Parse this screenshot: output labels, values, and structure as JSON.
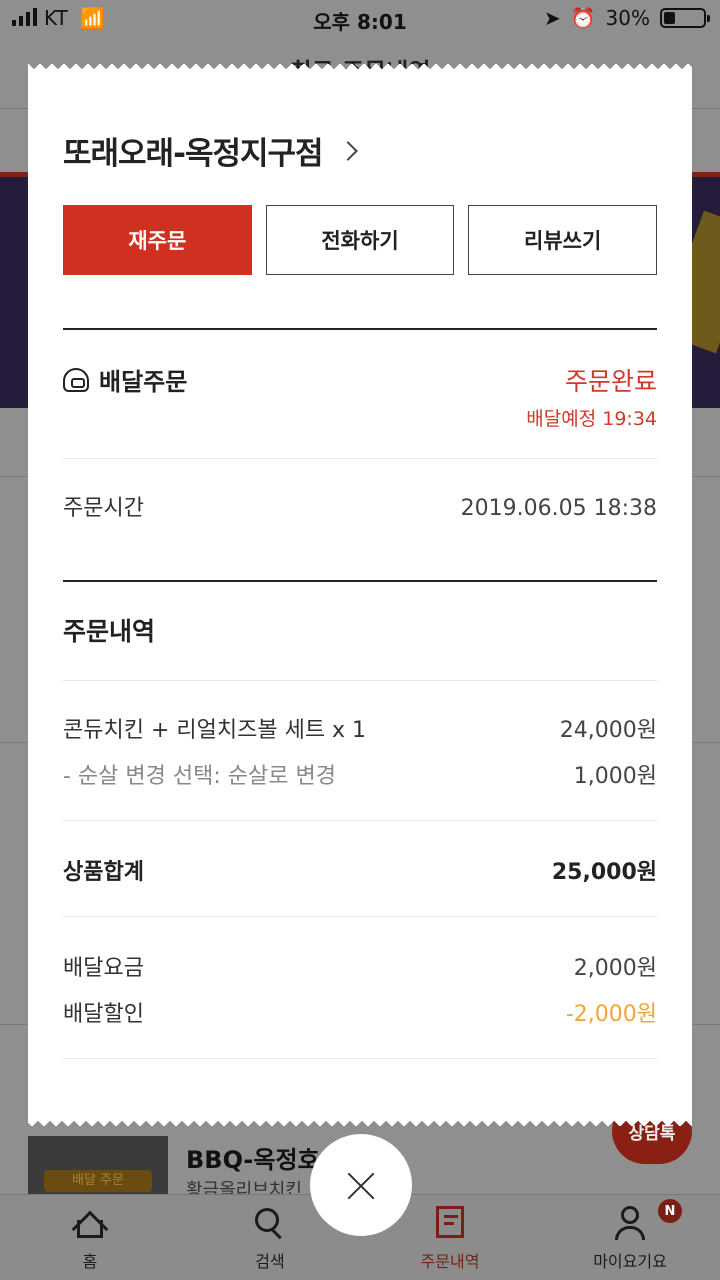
{
  "status_bar": {
    "carrier": "KT",
    "time": "오후 8:01",
    "battery": "30%",
    "battery_level": 0.3
  },
  "background": {
    "page_title": "최근 주문내역",
    "card_tag": "배달 주문",
    "card_title": "BBQ-옥정호수",
    "card_subtitle": "황금올리브치킨",
    "chat_label": "상담톡"
  },
  "receipt": {
    "store_name": "또래오래-옥정지구점",
    "buttons": {
      "reorder": "재주문",
      "call": "전화하기",
      "review": "리뷰쓰기"
    },
    "delivery": {
      "type_label": "배달주문",
      "status": "주문완료",
      "eta": "배달예정 19:34"
    },
    "order_time": {
      "label": "주문시간",
      "value": "2019.06.05 18:38"
    },
    "order_details": {
      "title": "주문내역",
      "items": [
        {
          "name": "콘듀치킨 + 리얼치즈볼 세트 x 1",
          "price": "24,000원"
        },
        {
          "name": "- 순살 변경 선택: 순살로 변경",
          "price": "1,000원"
        }
      ],
      "subtotal_label": "상품합계",
      "subtotal": "25,000원",
      "delivery_fee_label": "배달요금",
      "delivery_fee": "2,000원",
      "delivery_discount_label": "배달할인",
      "delivery_discount": "-2,000원"
    }
  },
  "tabbar": {
    "tabs": [
      {
        "label": "홈",
        "icon": "home-icon"
      },
      {
        "label": "검색",
        "icon": "search-icon"
      },
      {
        "label": "주문내역",
        "icon": "order-history-icon",
        "active": true
      },
      {
        "label": "마이요기요",
        "icon": "my-page-icon",
        "badge": "N"
      }
    ]
  },
  "colors": {
    "accent": "#cf3020",
    "status_red": "#d13a2a",
    "discount_orange": "#f2a43a"
  }
}
